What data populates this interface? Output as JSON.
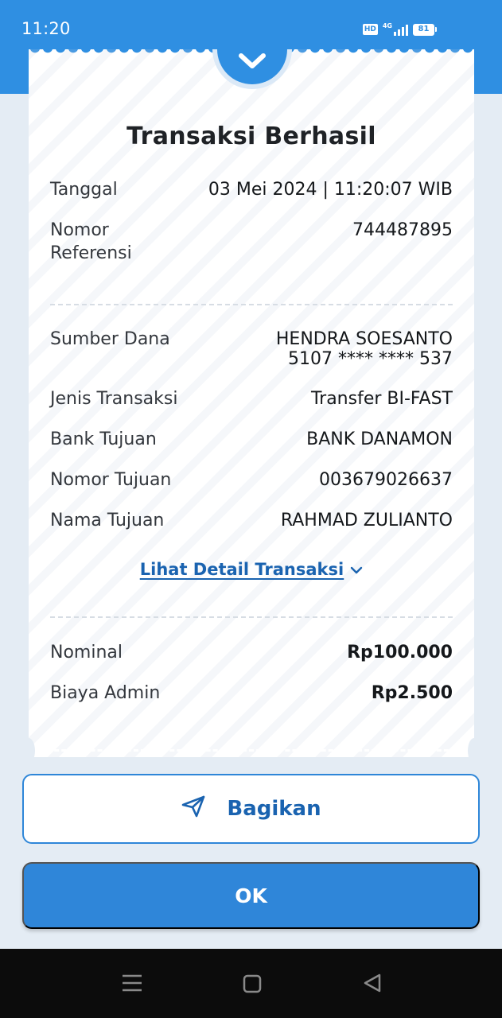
{
  "status_bar": {
    "time": "11:20",
    "hd": "HD",
    "network": "4G",
    "battery": "81"
  },
  "receipt": {
    "title": "Transaksi Berhasil",
    "tanggal": {
      "label": "Tanggal",
      "value": "03 Mei 2024 | 11:20:07 WIB"
    },
    "referensi": {
      "label": "Nomor Referensi",
      "value": "744487895"
    },
    "sumber_dana": {
      "label": "Sumber Dana",
      "name": "HENDRA SOESANTO",
      "account": "5107 **** **** 537"
    },
    "jenis_transaksi": {
      "label": "Jenis Transaksi",
      "value": "Transfer BI-FAST"
    },
    "bank_tujuan": {
      "label": "Bank Tujuan",
      "value": "BANK DANAMON"
    },
    "nomor_tujuan": {
      "label": "Nomor Tujuan",
      "value": "003679026637"
    },
    "nama_tujuan": {
      "label": "Nama Tujuan",
      "value": "RAHMAD ZULIANTO"
    },
    "detail_link": "Lihat Detail Transaksi",
    "nominal": {
      "label": "Nominal",
      "value": "Rp100.000"
    },
    "biaya_admin": {
      "label": "Biaya Admin",
      "value": "Rp2.500"
    }
  },
  "actions": {
    "share_label": "Bagikan",
    "ok_label": "OK"
  },
  "icons": {
    "status": "check-icon",
    "share": "send-icon",
    "expand": "chevron-down-icon",
    "nav": [
      "recents-icon",
      "home-icon",
      "back-icon"
    ]
  },
  "colors": {
    "primary": "#2f8fe2",
    "link": "#1a63b0",
    "background": "#e4ecf4"
  }
}
